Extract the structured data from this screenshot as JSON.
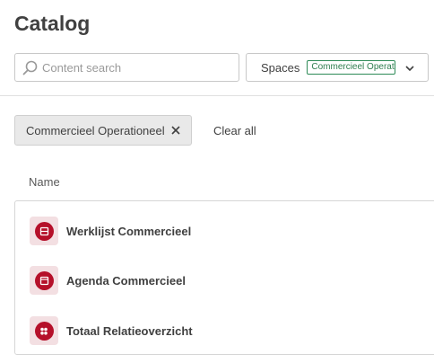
{
  "header": {
    "title": "Catalog"
  },
  "search": {
    "placeholder": "Content search",
    "value": ""
  },
  "spaces_filter": {
    "label": "Spaces",
    "selected": "Commercieel Operationeel"
  },
  "active_filters": {
    "chips": [
      {
        "label": "Commercieel Operationeel"
      }
    ],
    "clear_all_label": "Clear all"
  },
  "table": {
    "column_header": "Name",
    "items": [
      {
        "label": "Werklijst Commercieel",
        "icon": "sheet-icon"
      },
      {
        "label": "Agenda Commercieel",
        "icon": "sheet-icon"
      },
      {
        "label": "Totaal Relatieoverzicht",
        "icon": "users-icon"
      }
    ]
  },
  "colors": {
    "accent": "#b5102a",
    "accent_bg": "#f3dfe2",
    "chip_green": "#2e8b57"
  }
}
